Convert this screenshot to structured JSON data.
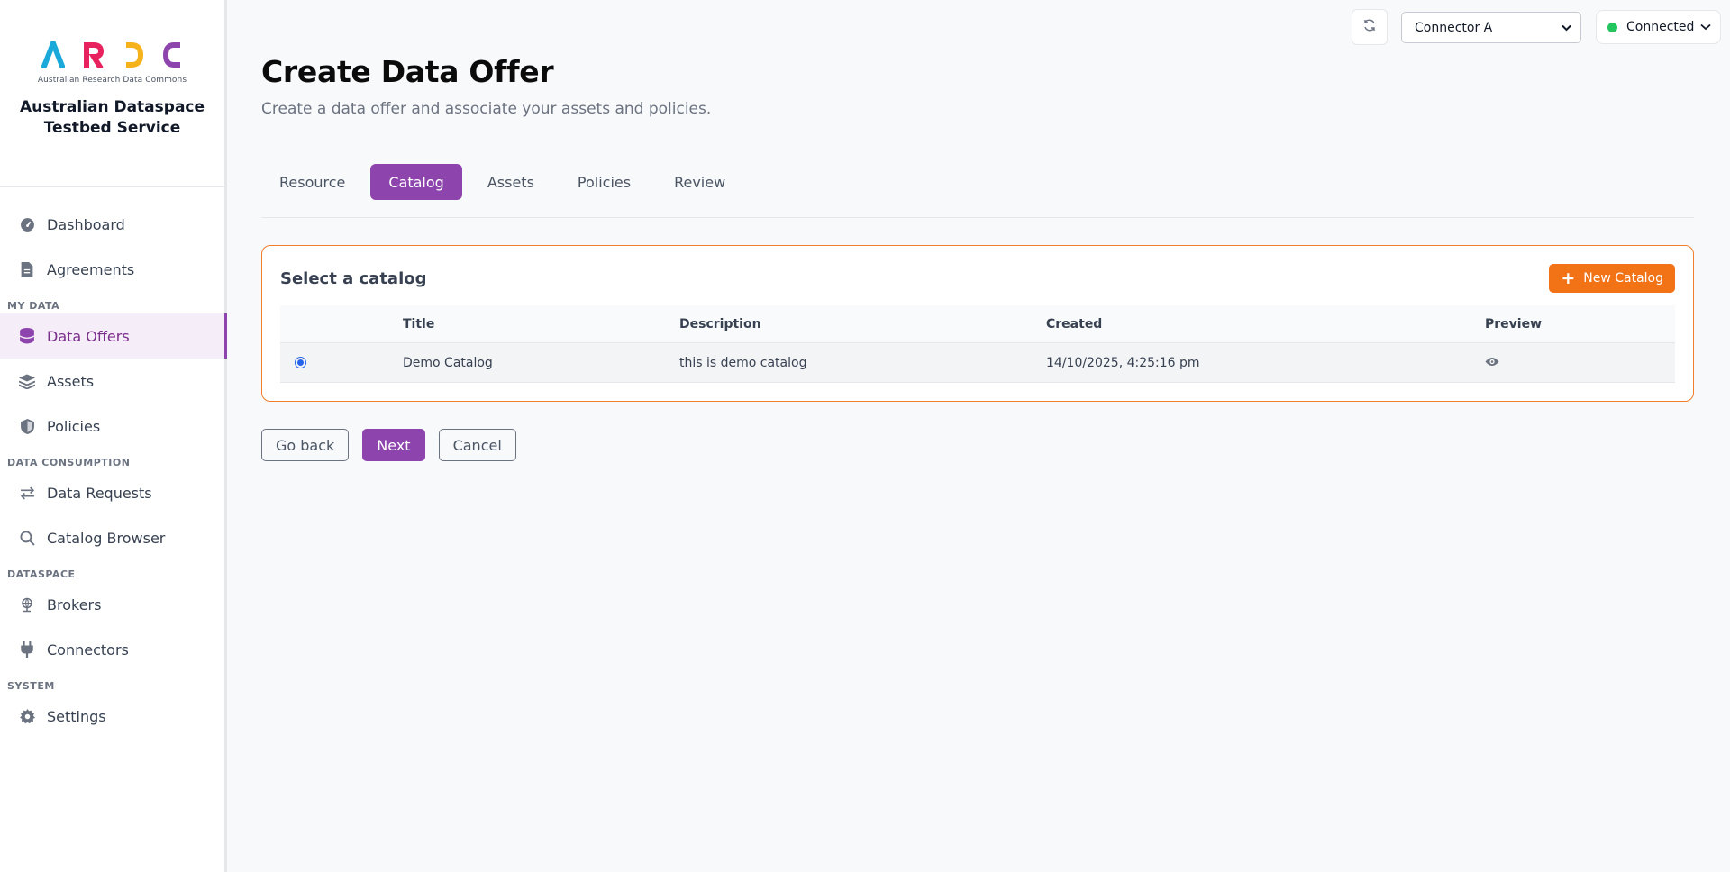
{
  "brand": {
    "logo_letters": [
      "A",
      "R",
      "D",
      "C"
    ],
    "logo_colors": [
      "#1aa9d8",
      "#e8225f",
      "#f6b21b",
      "#8e44ad"
    ],
    "logo_subtitle": "Australian Research Data Commons",
    "title": "Australian Dataspace Testbed Service"
  },
  "sidebar": {
    "items": [
      {
        "label": "Dashboard",
        "icon": "gauge-icon"
      },
      {
        "label": "Agreements",
        "icon": "document-icon"
      }
    ],
    "sections": [
      {
        "label": "MY DATA",
        "items": [
          {
            "label": "Data Offers",
            "icon": "database-icon",
            "active": true
          },
          {
            "label": "Assets",
            "icon": "layers-icon"
          },
          {
            "label": "Policies",
            "icon": "shield-icon"
          }
        ]
      },
      {
        "label": "DATA CONSUMPTION",
        "items": [
          {
            "label": "Data Requests",
            "icon": "arrows-exchange-icon"
          },
          {
            "label": "Catalog Browser",
            "icon": "search-icon"
          }
        ]
      },
      {
        "label": "DATASPACE",
        "items": [
          {
            "label": "Brokers",
            "icon": "globe-icon"
          },
          {
            "label": "Connectors",
            "icon": "plug-icon"
          }
        ]
      },
      {
        "label": "SYSTEM",
        "items": [
          {
            "label": "Settings",
            "icon": "gear-icon"
          }
        ]
      }
    ]
  },
  "topbar": {
    "refresh_icon": "refresh-icon",
    "connector_selected": "Connector A",
    "status_label": "Connected",
    "status_color": "#22c55e"
  },
  "page": {
    "title": "Create Data Offer",
    "subtitle": "Create a data offer and associate your assets and policies."
  },
  "tabs": [
    {
      "label": "Resource",
      "active": false
    },
    {
      "label": "Catalog",
      "active": true
    },
    {
      "label": "Assets",
      "active": false
    },
    {
      "label": "Policies",
      "active": false
    },
    {
      "label": "Review",
      "active": false
    }
  ],
  "catalog_card": {
    "title": "Select a catalog",
    "new_button": "New Catalog",
    "columns": [
      "",
      "Title",
      "Description",
      "Created",
      "Preview"
    ],
    "rows": [
      {
        "selected": true,
        "title": "Demo Catalog",
        "description": "this is demo catalog",
        "created": "14/10/2025, 4:25:16 pm",
        "preview_icon": "eye-icon"
      }
    ]
  },
  "actions": {
    "go_back": "Go back",
    "next": "Next",
    "cancel": "Cancel"
  },
  "colors": {
    "accent": "#8e44ad",
    "orange": "#f27216"
  }
}
